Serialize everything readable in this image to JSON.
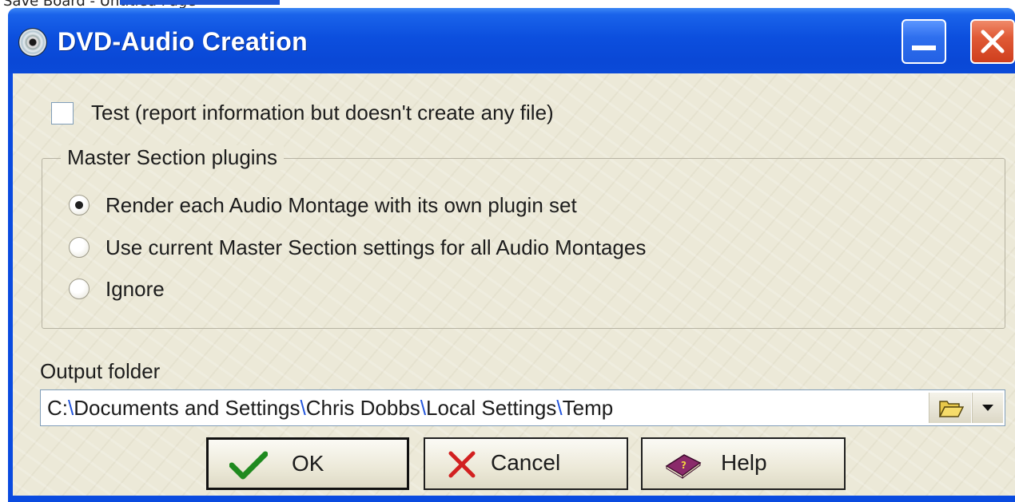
{
  "top_strip": {
    "text": "Save Board - Untitled Page"
  },
  "window": {
    "title": "DVD-Audio Creation",
    "icon": "cd-disc-icon",
    "controls": {
      "minimize": "minimize-icon",
      "close": "close-icon"
    }
  },
  "test_option": {
    "label": "Test (report information but doesn't create any file)",
    "checked": false
  },
  "master_section": {
    "title": "Master Section plugins",
    "options": [
      {
        "label": "Render each Audio Montage with its own plugin set",
        "selected": true
      },
      {
        "label": "Use current Master Section settings for all Audio Montages",
        "selected": false
      },
      {
        "label": "Ignore",
        "selected": false
      }
    ]
  },
  "output": {
    "label": "Output folder",
    "path_parts": [
      "C:",
      "Documents and Settings",
      "Chris Dobbs",
      "Local Settings",
      "Temp"
    ],
    "separator": "\\",
    "browse_icon": "folder-open-icon",
    "dropdown_icon": "chevron-down-icon"
  },
  "buttons": {
    "ok": "OK",
    "cancel": "Cancel",
    "help": "Help"
  },
  "colors": {
    "title_bar": "#0a48d6",
    "client_bg": "#ece9d8",
    "close_button": "#e05a36",
    "path_separator": "#2255dd"
  }
}
